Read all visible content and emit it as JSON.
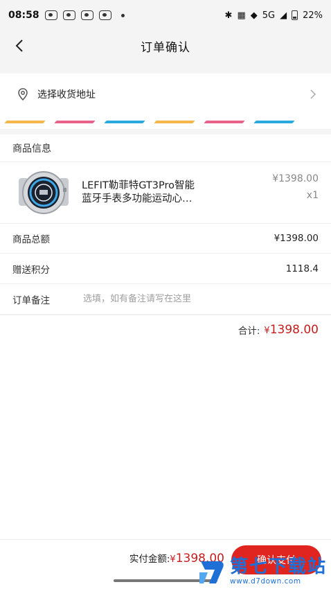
{
  "status_bar": {
    "time": "08:58",
    "network": "5G",
    "battery": "22%"
  },
  "header": {
    "title": "订单确认"
  },
  "address": {
    "label": "选择收货地址"
  },
  "stripes": [
    "#f4b74a",
    "#e8628c",
    "#2aa9e0",
    "#f4b74a",
    "#e8628c",
    "#2aa9e0"
  ],
  "goods": {
    "section_title": "商品信息",
    "items": [
      {
        "name_line1": "LEFIT勒菲特GT3Pro智能",
        "name_line2": "蓝牙手表多功能运动心…",
        "price": "¥1398.00",
        "qty": "x1"
      }
    ]
  },
  "summary": {
    "total_label": "商品总额",
    "total_value": "¥1398.00",
    "points_label": "赠送积分",
    "points_value": "1118.4",
    "remark_label": "订单备注",
    "remark_placeholder": "选填，如有备注请写在这里"
  },
  "footer_total": {
    "label": "合计:",
    "currency": "¥",
    "amount": "1398.00"
  },
  "bottom": {
    "pay_label": "实付金额:",
    "currency": "¥",
    "amount": "1398.00",
    "button": "确认支付"
  },
  "watermark": {
    "title": "第七下载站",
    "url": "www.d7down.com"
  },
  "colors": {
    "accent": "#e0241f",
    "price_red": "#c41d1d",
    "watermark_blue": "#1e6fd6"
  }
}
